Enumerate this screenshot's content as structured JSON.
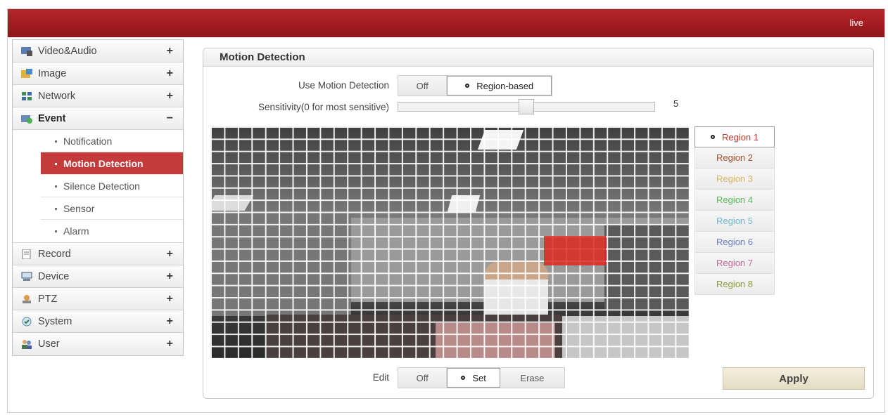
{
  "topbar": {
    "live_label": "live"
  },
  "sidebar": {
    "items": [
      {
        "label": "Video&Audio",
        "toggle": "+",
        "icon": "video-audio-icon"
      },
      {
        "label": "Image",
        "toggle": "+",
        "icon": "image-icon"
      },
      {
        "label": "Network",
        "toggle": "+",
        "icon": "network-icon"
      },
      {
        "label": "Event",
        "toggle": "−",
        "icon": "event-icon"
      },
      {
        "label": "Record",
        "toggle": "+",
        "icon": "record-icon"
      },
      {
        "label": "Device",
        "toggle": "+",
        "icon": "device-icon"
      },
      {
        "label": "PTZ",
        "toggle": "+",
        "icon": "ptz-icon"
      },
      {
        "label": "System",
        "toggle": "+",
        "icon": "system-icon"
      },
      {
        "label": "User",
        "toggle": "+",
        "icon": "user-icon"
      }
    ],
    "event_sub": [
      {
        "label": "Notification"
      },
      {
        "label": "Motion Detection",
        "active": true
      },
      {
        "label": "Silence Detection"
      },
      {
        "label": "Sensor"
      },
      {
        "label": "Alarm"
      }
    ]
  },
  "panel": {
    "title": "Motion Detection",
    "use_label": "Use Motion Detection",
    "use_options": [
      "Off",
      "Region-based"
    ],
    "use_selected": "Region-based",
    "sensitivity_label": "Sensitivity(0 for most sensitive)",
    "sensitivity_value": "5",
    "sensitivity_fraction": 0.5,
    "edit_label": "Edit",
    "edit_options": [
      "Off",
      "Set",
      "Erase"
    ],
    "edit_selected": "Set",
    "regions": [
      {
        "label": "Region 1",
        "color": "#c0392b",
        "selected": true
      },
      {
        "label": "Region 2",
        "color": "#a0522d"
      },
      {
        "label": "Region 3",
        "color": "#d9b36b"
      },
      {
        "label": "Region 4",
        "color": "#5cb85c"
      },
      {
        "label": "Region 5",
        "color": "#6fb7c9"
      },
      {
        "label": "Region 6",
        "color": "#6c80c0"
      },
      {
        "label": "Region 7",
        "color": "#c06a9a"
      },
      {
        "label": "Region 8",
        "color": "#8a9a3a"
      }
    ],
    "apply_label": "Apply"
  }
}
